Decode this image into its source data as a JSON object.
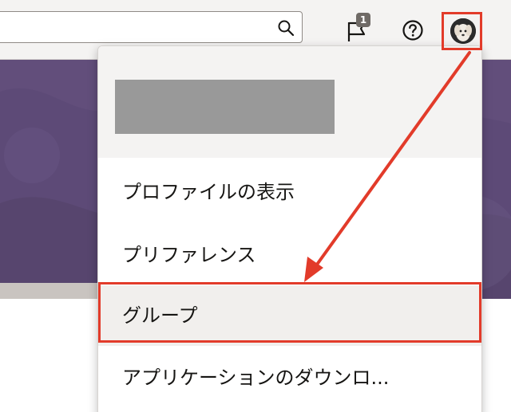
{
  "topbar": {
    "search_placeholder": "",
    "notifications_count": "1",
    "icons": {
      "search": "search-icon",
      "flag": "flag-icon",
      "help": "help-icon",
      "avatar": "user-avatar"
    }
  },
  "user_menu": {
    "items": [
      {
        "label": "プロファイルの表示"
      },
      {
        "label": "プリファレンス"
      },
      {
        "label": "グループ"
      },
      {
        "label": "アプリケーションのダウンロ..."
      }
    ]
  },
  "colors": {
    "highlight": "#e23b2a",
    "banner": "#5d4a77"
  }
}
